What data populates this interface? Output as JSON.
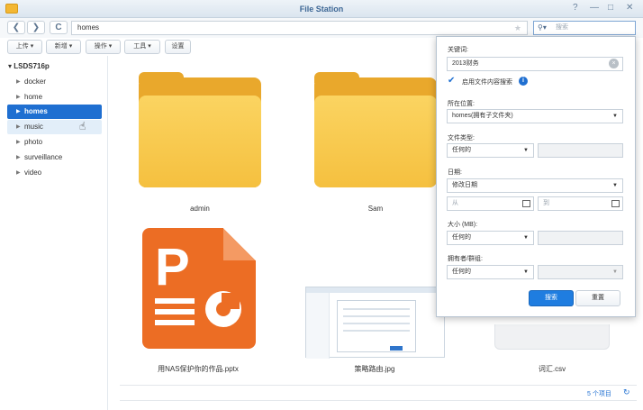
{
  "window": {
    "title": "File Station",
    "controls": [
      "?",
      "—",
      "□",
      "✕"
    ]
  },
  "navigation": {
    "back": "❮",
    "forward": "❯",
    "refresh": "C",
    "path": "homes",
    "search_placeholder": "搜索"
  },
  "toolbar": {
    "buttons": [
      "上传 ▾",
      "新增 ▾",
      "操作 ▾",
      "工具 ▾",
      "设置"
    ]
  },
  "sidebar": {
    "server": "LSDS716p",
    "items": [
      {
        "label": "docker"
      },
      {
        "label": "home"
      },
      {
        "label": "homes",
        "selected": true
      },
      {
        "label": "music",
        "hover": true
      },
      {
        "label": "photo"
      },
      {
        "label": "surveillance"
      },
      {
        "label": "video"
      }
    ]
  },
  "files": [
    {
      "name": "admin",
      "type": "folder"
    },
    {
      "name": "Sam",
      "type": "folder"
    },
    {
      "name": "用NAS保护你的作品.pptx",
      "type": "pptx"
    },
    {
      "name": "策略路由.jpg",
      "type": "image"
    },
    {
      "name": "词汇.csv",
      "type": "csv"
    }
  ],
  "status": {
    "count": "5 个项目"
  },
  "search_panel": {
    "keyword_label": "关键词:",
    "keyword_value": "2013财务",
    "fulltext_label": "启用文件内容搜索",
    "location_label": "所在位置:",
    "location_value": "homes(拥有子文件夹)",
    "filetype_label": "文件类型:",
    "filetype_value": "任何的",
    "date_label": "日期:",
    "date_value": "修改日期",
    "from_placeholder": "从",
    "to_placeholder": "到",
    "size_label": "大小 (MB):",
    "size_value": "任何的",
    "owner_label": "拥有者/群组:",
    "owner_value": "任何的",
    "search_button": "搜索",
    "reset_button": "重置"
  }
}
